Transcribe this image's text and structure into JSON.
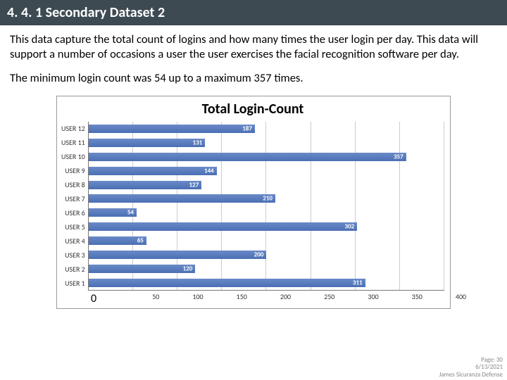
{
  "header": {
    "title": "4. 4. 1 Secondary Dataset 2"
  },
  "para1": "This data capture the total count of logins and how many times the user login per day. This data will support a number of occasions a user the user exercises the facial recognition software per day.",
  "para2": "The minimum login count was 54 up to a maximum 357 times.",
  "chart_data": {
    "type": "bar",
    "orientation": "horizontal",
    "title": "Total Login-Count",
    "categories": [
      "USER 12",
      "USER 11",
      "USER 10",
      "USER 9",
      "USER 8",
      "USER 7",
      "USER 6",
      "USER 5",
      "USER 4",
      "USER 3",
      "USER 2",
      "USER 1"
    ],
    "values": [
      187,
      131,
      357,
      144,
      127,
      210,
      54,
      302,
      65,
      200,
      120,
      311
    ],
    "xticks": [
      0,
      50,
      100,
      150,
      200,
      250,
      300,
      350,
      400
    ],
    "xlim": [
      0,
      400
    ],
    "bar_color": "#4a6fb3"
  },
  "footer": {
    "page": "Page: 30",
    "date": "6/13/2021",
    "author": "James Sicuranza Defense"
  }
}
